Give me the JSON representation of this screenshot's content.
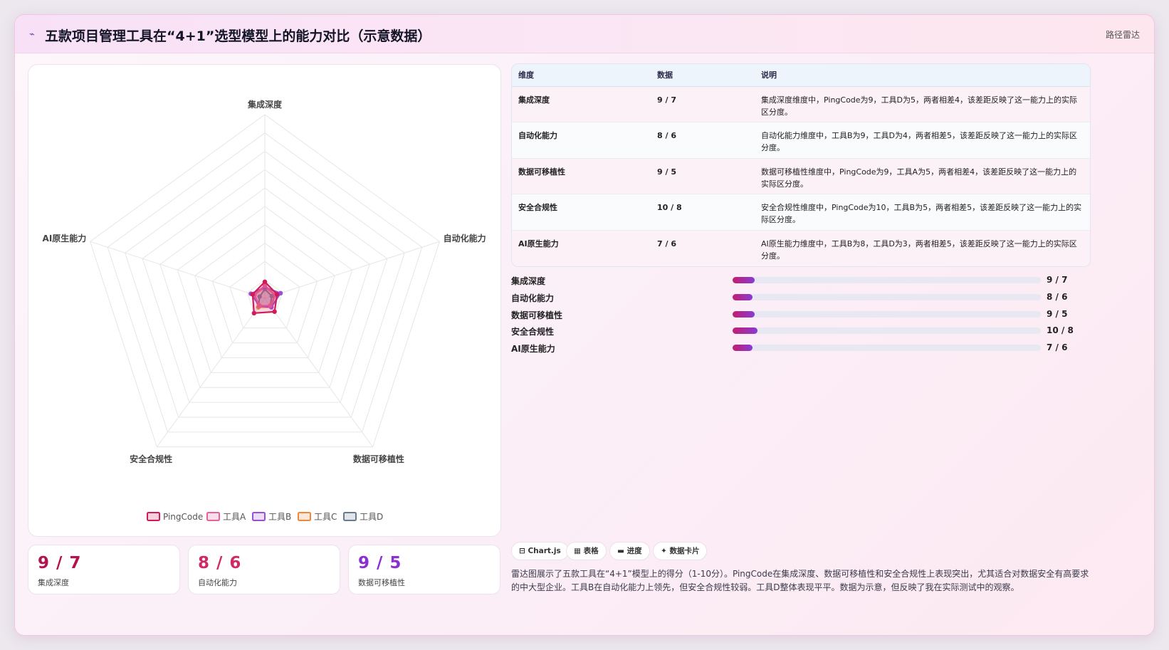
{
  "header": {
    "icon": "chart-line-icon",
    "title": "五款项目管理工具在“4+1”选型模型上的能力对比（示意数据）",
    "tag": "路径雷达"
  },
  "chart_data": {
    "type": "radar",
    "axes": [
      "集成深度",
      "自动化能力",
      "数据可移植性",
      "安全合规性",
      "AI原生能力"
    ],
    "rlim": [
      0,
      100
    ],
    "grid": true,
    "legend_position": "bottom",
    "series": [
      {
        "name": "PingCode",
        "values": [
          9,
          7,
          9,
          10,
          7
        ],
        "color": "#d11a58"
      },
      {
        "name": "工具A",
        "values": [
          7,
          6,
          5,
          5,
          6
        ],
        "color": "#e8609c"
      },
      {
        "name": "工具B",
        "values": [
          6,
          9,
          6,
          5,
          8
        ],
        "color": "#9b4fd8"
      },
      {
        "name": "工具C",
        "values": [
          6,
          6,
          6,
          6,
          6
        ],
        "color": "#f0883a"
      },
      {
        "name": "工具D",
        "values": [
          5,
          4,
          5,
          6,
          3
        ],
        "color": "#6a7a92"
      }
    ]
  },
  "table": {
    "headers": [
      "维度",
      "数据",
      "说明"
    ],
    "rows": [
      {
        "dim": "集成深度",
        "value": "9 / 7",
        "note": "集成深度维度中，PingCode为9，工具D为5，两者相差4，该差距反映了这一能力上的实际区分度。"
      },
      {
        "dim": "自动化能力",
        "value": "8 / 6",
        "note": "自动化能力维度中，工具B为9，工具D为4，两者相差5，该差距反映了这一能力上的实际区分度。"
      },
      {
        "dim": "数据可移植性",
        "value": "9 / 5",
        "note": "数据可移植性维度中，PingCode为9，工具A为5，两者相差4，该差距反映了这一能力上的实际区分度。"
      },
      {
        "dim": "安全合规性",
        "value": "10 / 8",
        "note": "安全合规性维度中，PingCode为10，工具B为5，两者相差5，该差距反映了这一能力上的实际区分度。"
      },
      {
        "dim": "AI原生能力",
        "value": "7 / 6",
        "note": "AI原生能力维度中，工具B为8，工具D为3，两者相差5，该差距反映了这一能力上的实际区分度。"
      }
    ]
  },
  "bars": [
    {
      "label": "集成深度",
      "value": "9 / 7",
      "progress": 0.072
    },
    {
      "label": "自动化能力",
      "value": "8 / 6",
      "progress": 0.064
    },
    {
      "label": "数据可移植性",
      "value": "9 / 5",
      "progress": 0.072
    },
    {
      "label": "安全合规性",
      "value": "10 / 8",
      "progress": 0.08
    },
    {
      "label": "AI原生能力",
      "value": "7 / 6",
      "progress": 0.064
    }
  ],
  "stats": [
    {
      "value": "9 / 7",
      "label": "集成深度",
      "color": "#b3124e"
    },
    {
      "value": "8 / 6",
      "label": "自动化能力",
      "color": "#cf2a66"
    },
    {
      "value": "9 / 5",
      "label": "数据可移植性",
      "color": "#8b2fd0"
    }
  ],
  "chips": [
    {
      "icon": "chart-icon",
      "label": "⊟ Chart.js"
    },
    {
      "icon": "table-icon",
      "label": "▦ 表格"
    },
    {
      "icon": "progress-icon",
      "label": "▬ 进度"
    },
    {
      "icon": "card-icon",
      "label": "✦ 数据卡片"
    }
  ],
  "summary": "雷达图展示了五款工具在“4+1”模型上的得分（1-10分）。PingCode在集成深度、数据可移植性和安全合规性上表现突出，尤其适合对数据安全有高要求的中大型企业。工具B在自动化能力上领先，但安全合规性较弱。工具D整体表现平平。数据为示意，但反映了我在实际测试中的观察。"
}
